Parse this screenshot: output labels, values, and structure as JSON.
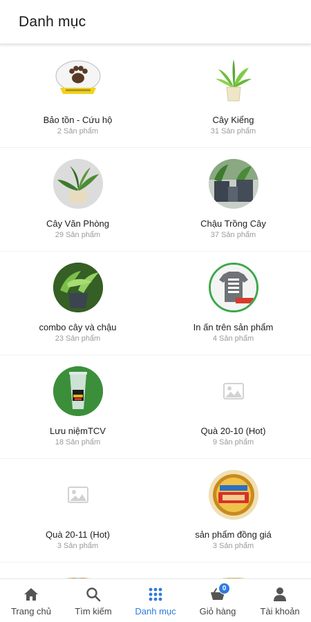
{
  "header": {
    "title": "Danh mục"
  },
  "categories": [
    {
      "name": "Bảo tồn - Cứu hộ",
      "count": "2 Sản phẩm",
      "icon": "paw-logo-image"
    },
    {
      "name": "Cây Kiểng",
      "count": "31 Sản phẩm",
      "icon": "potted-plant-image"
    },
    {
      "name": "Cây Văn Phòng",
      "count": "29 Sản phẩm",
      "icon": "office-plant-image"
    },
    {
      "name": "Chậu Trồng Cây",
      "count": "37 Sản phẩm",
      "icon": "planter-pots-image"
    },
    {
      "name": "combo cây và chậu",
      "count": "23 Sản phẩm",
      "icon": "plant-combo-image"
    },
    {
      "name": "In ấn trên sản phẩm",
      "count": "4 Sản phẩm",
      "icon": "printed-tshirt-image"
    },
    {
      "name": "Lưu niệmTCV",
      "count": "18 Sản phẩm",
      "icon": "souvenir-cup-image"
    },
    {
      "name": "Quà 20-10 (Hot)",
      "count": "9 Sản phẩm",
      "icon": "image-placeholder-icon"
    },
    {
      "name": "Quà 20-11 (Hot)",
      "count": "3 Sản phẩm",
      "icon": "image-placeholder-icon"
    },
    {
      "name": "sản phẩm đồng giá",
      "count": "3 Sản phẩm",
      "icon": "same-price-50k-badge-image"
    }
  ],
  "bottom_nav": {
    "items": [
      {
        "label": "Trang chủ",
        "icon": "home-icon"
      },
      {
        "label": "Tìm kiếm",
        "icon": "search-icon"
      },
      {
        "label": "Danh mục",
        "icon": "grid-icon",
        "active": true
      },
      {
        "label": "Giỏ hàng",
        "icon": "cart-icon",
        "badge": "0"
      },
      {
        "label": "Tài khoản",
        "icon": "account-icon"
      }
    ]
  },
  "colors": {
    "accent": "#2d7be0",
    "count_text": "#9a9a9a"
  }
}
